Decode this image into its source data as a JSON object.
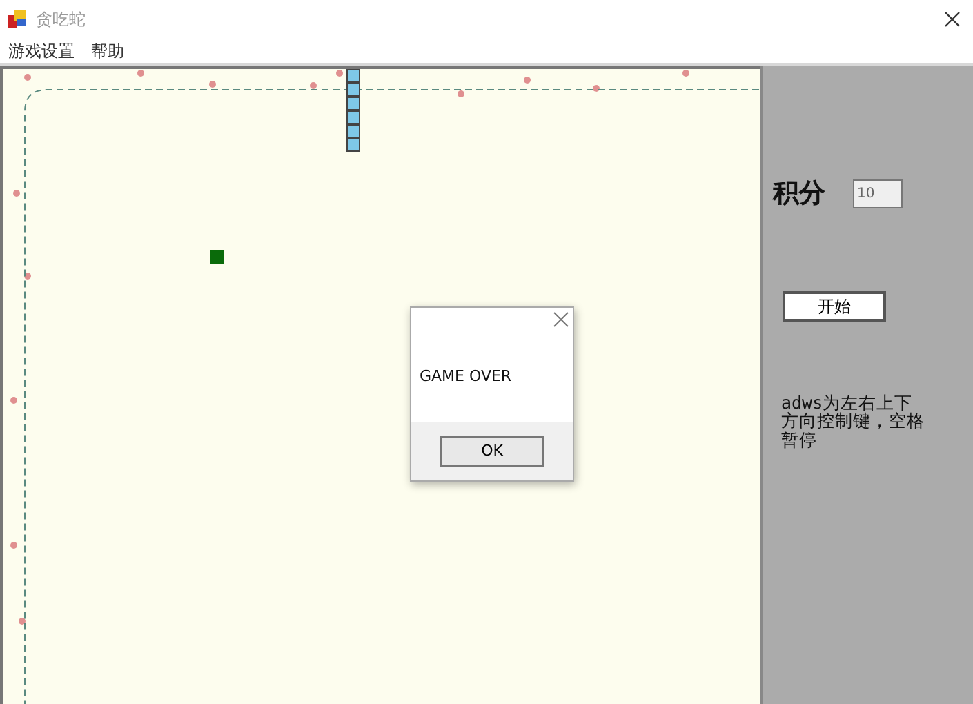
{
  "window": {
    "title": "贪吃蛇"
  },
  "menu": [
    {
      "label": "游戏设置"
    },
    {
      "label": "帮助"
    }
  ],
  "side_panel": {
    "score_label": "积分",
    "score_value": "10",
    "start_button": "开始",
    "help_text": "adws为左右上下方向控制键，空格暂停"
  },
  "dialog": {
    "message": "GAME OVER",
    "button": "OK"
  }
}
